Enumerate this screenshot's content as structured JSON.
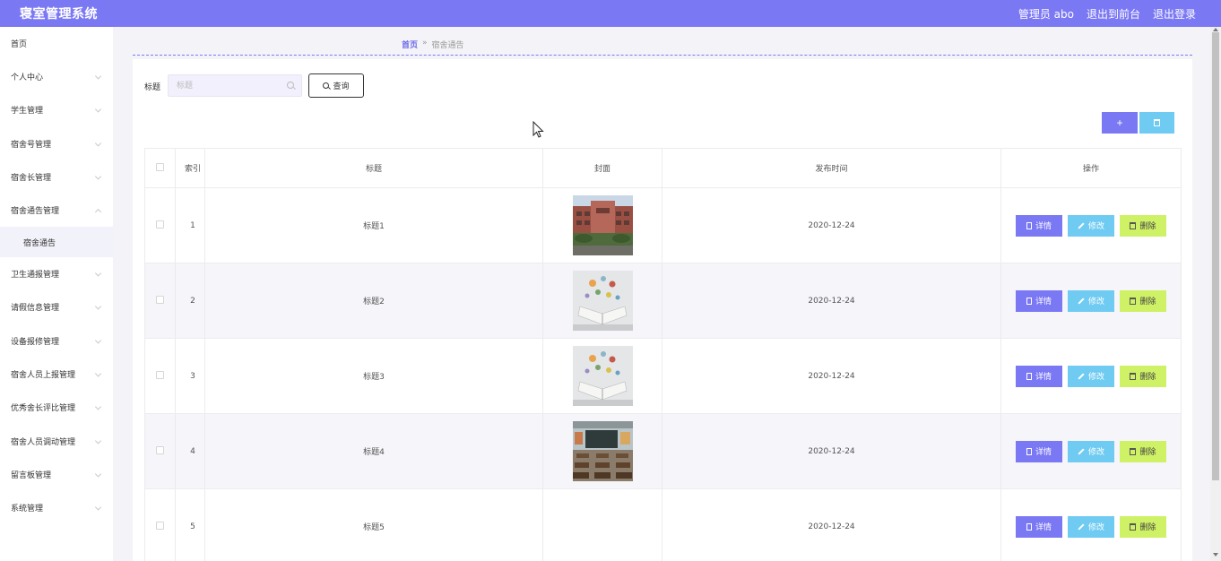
{
  "header": {
    "app_title": "寝室管理系统",
    "user_label": "管理员 abo",
    "to_front": "退出到前台",
    "logout": "退出登录",
    "accent_color": "#7B78F4"
  },
  "sidebar": {
    "items": [
      {
        "label": "首页"
      },
      {
        "label": "个人中心"
      },
      {
        "label": "学生管理"
      },
      {
        "label": "宿舍号管理"
      },
      {
        "label": "宿舍长管理"
      },
      {
        "label": "宿舍通告管理"
      },
      {
        "label": "宿舍通告"
      },
      {
        "label": "卫生通报管理"
      },
      {
        "label": "请假信息管理"
      },
      {
        "label": "设备报修管理"
      },
      {
        "label": "宿舍人员上报管理"
      },
      {
        "label": "优秀舍长评比管理"
      },
      {
        "label": "宿舍人员调动管理"
      },
      {
        "label": "留言板管理"
      },
      {
        "label": "系统管理"
      }
    ]
  },
  "breadcrumb": {
    "home": "首页",
    "separator": "»",
    "current": "宿舍通告"
  },
  "search": {
    "label": "标题",
    "placeholder": "标题",
    "query_label": "查询"
  },
  "toolbar": {
    "add_label": "+"
  },
  "table": {
    "headers": {
      "index": "索引",
      "title": "标题",
      "cover": "封面",
      "date": "发布时间",
      "actions": "操作"
    },
    "actions": {
      "detail": "详情",
      "edit": "修改",
      "delete": "删除"
    },
    "rows": [
      {
        "index": "1",
        "title": "标题1",
        "date": "2020-12-24",
        "cover": "school-building-image"
      },
      {
        "index": "2",
        "title": "标题2",
        "date": "2020-12-24",
        "cover": "open-book-image"
      },
      {
        "index": "3",
        "title": "标题3",
        "date": "2020-12-24",
        "cover": "open-book-image"
      },
      {
        "index": "4",
        "title": "标题4",
        "date": "2020-12-24",
        "cover": "classroom-image"
      },
      {
        "index": "5",
        "title": "标题5",
        "date": "2020-12-24",
        "cover": "none"
      }
    ]
  }
}
